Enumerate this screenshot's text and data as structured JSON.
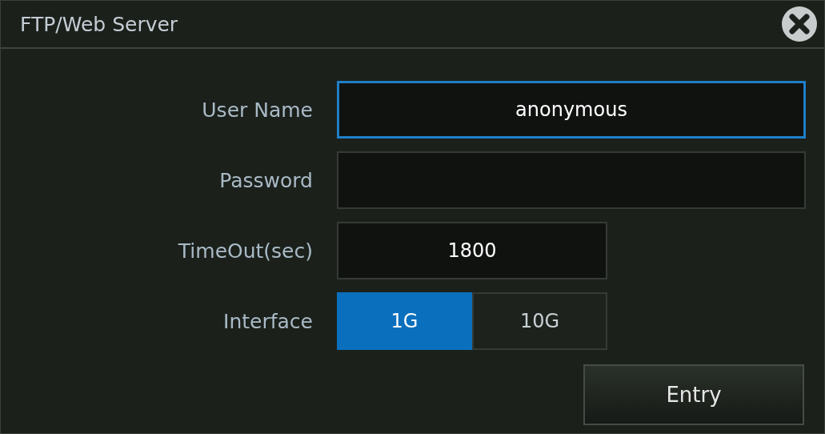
{
  "window": {
    "title": "FTP/Web Server"
  },
  "fields": [
    {
      "label": "User Name",
      "kind": "text",
      "value": "anonymous",
      "focused": true,
      "wide": true
    },
    {
      "label": "Password",
      "kind": "text",
      "focused": false,
      "wide": true
    },
    {
      "label": "TimeOut(sec)",
      "kind": "text",
      "value": "1800",
      "focused": false,
      "wide": false
    },
    {
      "label": "Interface",
      "kind": "segmented",
      "options": [
        {
          "label": "1G",
          "selected": true
        },
        {
          "label": "10G",
          "selected": false
        }
      ]
    }
  ],
  "buttons": [
    "Entry"
  ]
}
